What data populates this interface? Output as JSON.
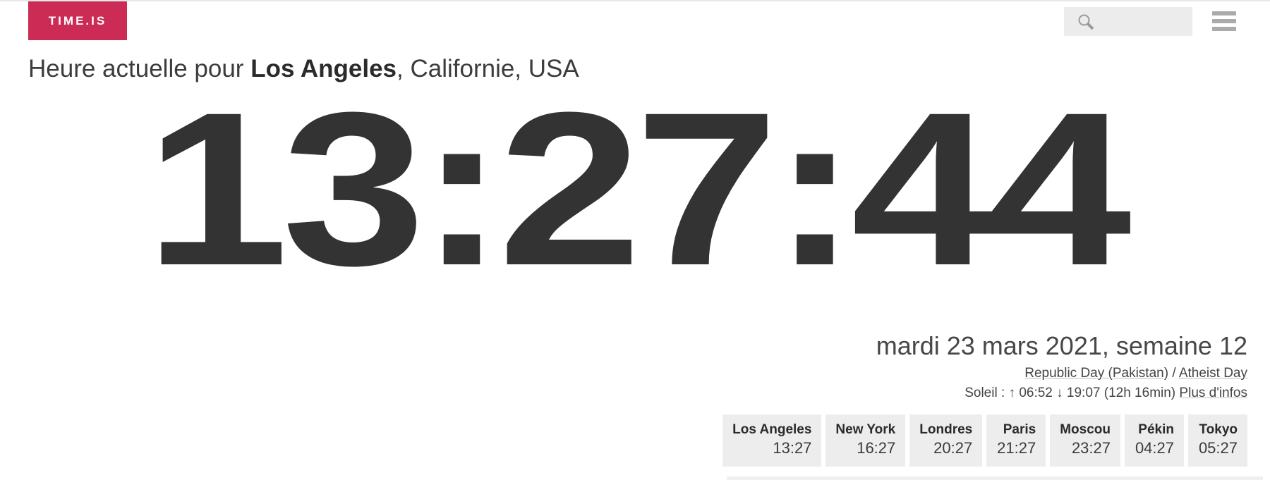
{
  "header": {
    "logo_text": "TIME.IS",
    "logo_color": "#cc2b55",
    "search": {
      "value": "",
      "placeholder": "",
      "icon": "search-icon"
    },
    "menu_icon": "hamburger-menu-icon"
  },
  "title": {
    "prefix": "Heure actuelle pour ",
    "place": "Los Angeles",
    "suffix": ", Californie, USA"
  },
  "clock": {
    "time": "13:27:44",
    "hours": "13",
    "minutes": "27",
    "seconds": "44",
    "color": "#333333"
  },
  "info": {
    "date_line": "mardi 23 mars 2021, semaine 12",
    "holidays": [
      "Republic Day (Pakistan)",
      "Atheist Day"
    ],
    "holiday_separator": " / ",
    "sun_label": "Soleil : ",
    "sunrise_arrow": "↑",
    "sunrise": "06:52",
    "sunset_arrow": "↓",
    "sunset": "19:07",
    "daylength": "(12h 16min)",
    "more_info_link": "Plus d'infos"
  },
  "cities": [
    {
      "name": "Los Angeles",
      "time": "13:27"
    },
    {
      "name": "New York",
      "time": "16:27"
    },
    {
      "name": "Londres",
      "time": "20:27"
    },
    {
      "name": "Paris",
      "time": "21:27"
    },
    {
      "name": "Moscou",
      "time": "23:27"
    },
    {
      "name": "Pékin",
      "time": "04:27"
    },
    {
      "name": "Tokyo",
      "time": "05:27"
    }
  ]
}
